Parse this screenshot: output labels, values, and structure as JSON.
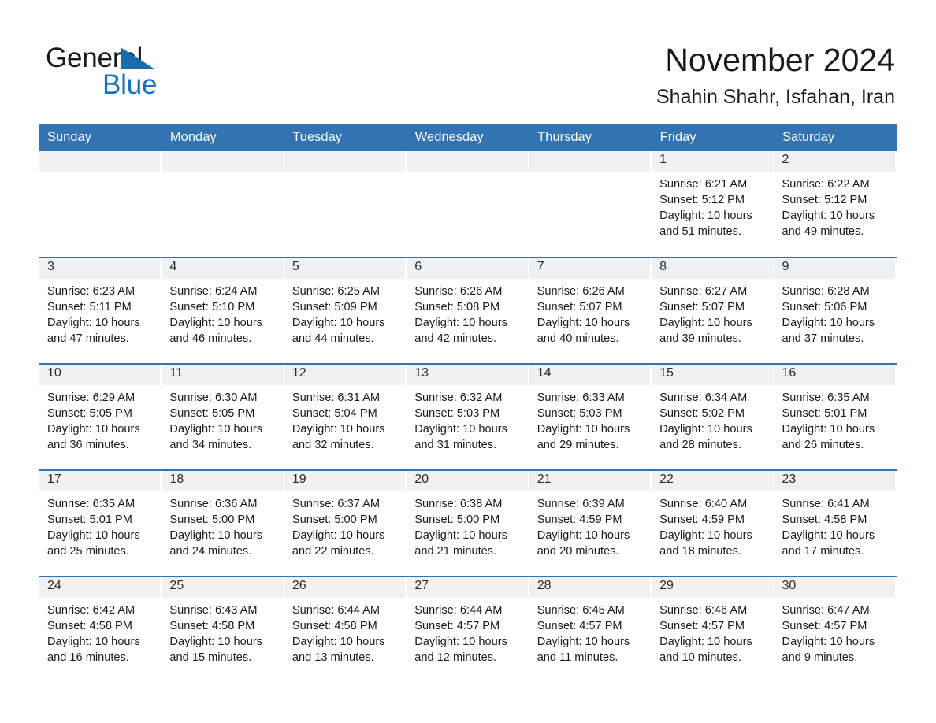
{
  "brand": {
    "name_part1": "General",
    "name_part2": "Blue",
    "triangle_icon": "triangle-icon",
    "accent_color": "#1673bd"
  },
  "header": {
    "title": "November 2024",
    "location": "Shahin Shahr, Isfahan, Iran"
  },
  "colors": {
    "header_blue": "#3273b4",
    "row_divider_blue": "#3273b4",
    "daynum_band": "#f1f1f1",
    "text": "#1a1a1a"
  },
  "weekday_headers": [
    "Sunday",
    "Monday",
    "Tuesday",
    "Wednesday",
    "Thursday",
    "Friday",
    "Saturday"
  ],
  "labels": {
    "sunrise_prefix": "Sunrise:",
    "sunset_prefix": "Sunset:",
    "daylight_prefix": "Daylight:"
  },
  "weeks": [
    [
      {
        "day": "",
        "info": ""
      },
      {
        "day": "",
        "info": ""
      },
      {
        "day": "",
        "info": ""
      },
      {
        "day": "",
        "info": ""
      },
      {
        "day": "",
        "info": ""
      },
      {
        "day": "1",
        "info": "Sunrise: 6:21 AM\nSunset: 5:12 PM\nDaylight: 10 hours and 51 minutes."
      },
      {
        "day": "2",
        "info": "Sunrise: 6:22 AM\nSunset: 5:12 PM\nDaylight: 10 hours and 49 minutes."
      }
    ],
    [
      {
        "day": "3",
        "info": "Sunrise: 6:23 AM\nSunset: 5:11 PM\nDaylight: 10 hours and 47 minutes."
      },
      {
        "day": "4",
        "info": "Sunrise: 6:24 AM\nSunset: 5:10 PM\nDaylight: 10 hours and 46 minutes."
      },
      {
        "day": "5",
        "info": "Sunrise: 6:25 AM\nSunset: 5:09 PM\nDaylight: 10 hours and 44 minutes."
      },
      {
        "day": "6",
        "info": "Sunrise: 6:26 AM\nSunset: 5:08 PM\nDaylight: 10 hours and 42 minutes."
      },
      {
        "day": "7",
        "info": "Sunrise: 6:26 AM\nSunset: 5:07 PM\nDaylight: 10 hours and 40 minutes."
      },
      {
        "day": "8",
        "info": "Sunrise: 6:27 AM\nSunset: 5:07 PM\nDaylight: 10 hours and 39 minutes."
      },
      {
        "day": "9",
        "info": "Sunrise: 6:28 AM\nSunset: 5:06 PM\nDaylight: 10 hours and 37 minutes."
      }
    ],
    [
      {
        "day": "10",
        "info": "Sunrise: 6:29 AM\nSunset: 5:05 PM\nDaylight: 10 hours and 36 minutes."
      },
      {
        "day": "11",
        "info": "Sunrise: 6:30 AM\nSunset: 5:05 PM\nDaylight: 10 hours and 34 minutes."
      },
      {
        "day": "12",
        "info": "Sunrise: 6:31 AM\nSunset: 5:04 PM\nDaylight: 10 hours and 32 minutes."
      },
      {
        "day": "13",
        "info": "Sunrise: 6:32 AM\nSunset: 5:03 PM\nDaylight: 10 hours and 31 minutes."
      },
      {
        "day": "14",
        "info": "Sunrise: 6:33 AM\nSunset: 5:03 PM\nDaylight: 10 hours and 29 minutes."
      },
      {
        "day": "15",
        "info": "Sunrise: 6:34 AM\nSunset: 5:02 PM\nDaylight: 10 hours and 28 minutes."
      },
      {
        "day": "16",
        "info": "Sunrise: 6:35 AM\nSunset: 5:01 PM\nDaylight: 10 hours and 26 minutes."
      }
    ],
    [
      {
        "day": "17",
        "info": "Sunrise: 6:35 AM\nSunset: 5:01 PM\nDaylight: 10 hours and 25 minutes."
      },
      {
        "day": "18",
        "info": "Sunrise: 6:36 AM\nSunset: 5:00 PM\nDaylight: 10 hours and 24 minutes."
      },
      {
        "day": "19",
        "info": "Sunrise: 6:37 AM\nSunset: 5:00 PM\nDaylight: 10 hours and 22 minutes."
      },
      {
        "day": "20",
        "info": "Sunrise: 6:38 AM\nSunset: 5:00 PM\nDaylight: 10 hours and 21 minutes."
      },
      {
        "day": "21",
        "info": "Sunrise: 6:39 AM\nSunset: 4:59 PM\nDaylight: 10 hours and 20 minutes."
      },
      {
        "day": "22",
        "info": "Sunrise: 6:40 AM\nSunset: 4:59 PM\nDaylight: 10 hours and 18 minutes."
      },
      {
        "day": "23",
        "info": "Sunrise: 6:41 AM\nSunset: 4:58 PM\nDaylight: 10 hours and 17 minutes."
      }
    ],
    [
      {
        "day": "24",
        "info": "Sunrise: 6:42 AM\nSunset: 4:58 PM\nDaylight: 10 hours and 16 minutes."
      },
      {
        "day": "25",
        "info": "Sunrise: 6:43 AM\nSunset: 4:58 PM\nDaylight: 10 hours and 15 minutes."
      },
      {
        "day": "26",
        "info": "Sunrise: 6:44 AM\nSunset: 4:58 PM\nDaylight: 10 hours and 13 minutes."
      },
      {
        "day": "27",
        "info": "Sunrise: 6:44 AM\nSunset: 4:57 PM\nDaylight: 10 hours and 12 minutes."
      },
      {
        "day": "28",
        "info": "Sunrise: 6:45 AM\nSunset: 4:57 PM\nDaylight: 10 hours and 11 minutes."
      },
      {
        "day": "29",
        "info": "Sunrise: 6:46 AM\nSunset: 4:57 PM\nDaylight: 10 hours and 10 minutes."
      },
      {
        "day": "30",
        "info": "Sunrise: 6:47 AM\nSunset: 4:57 PM\nDaylight: 10 hours and 9 minutes."
      }
    ]
  ]
}
